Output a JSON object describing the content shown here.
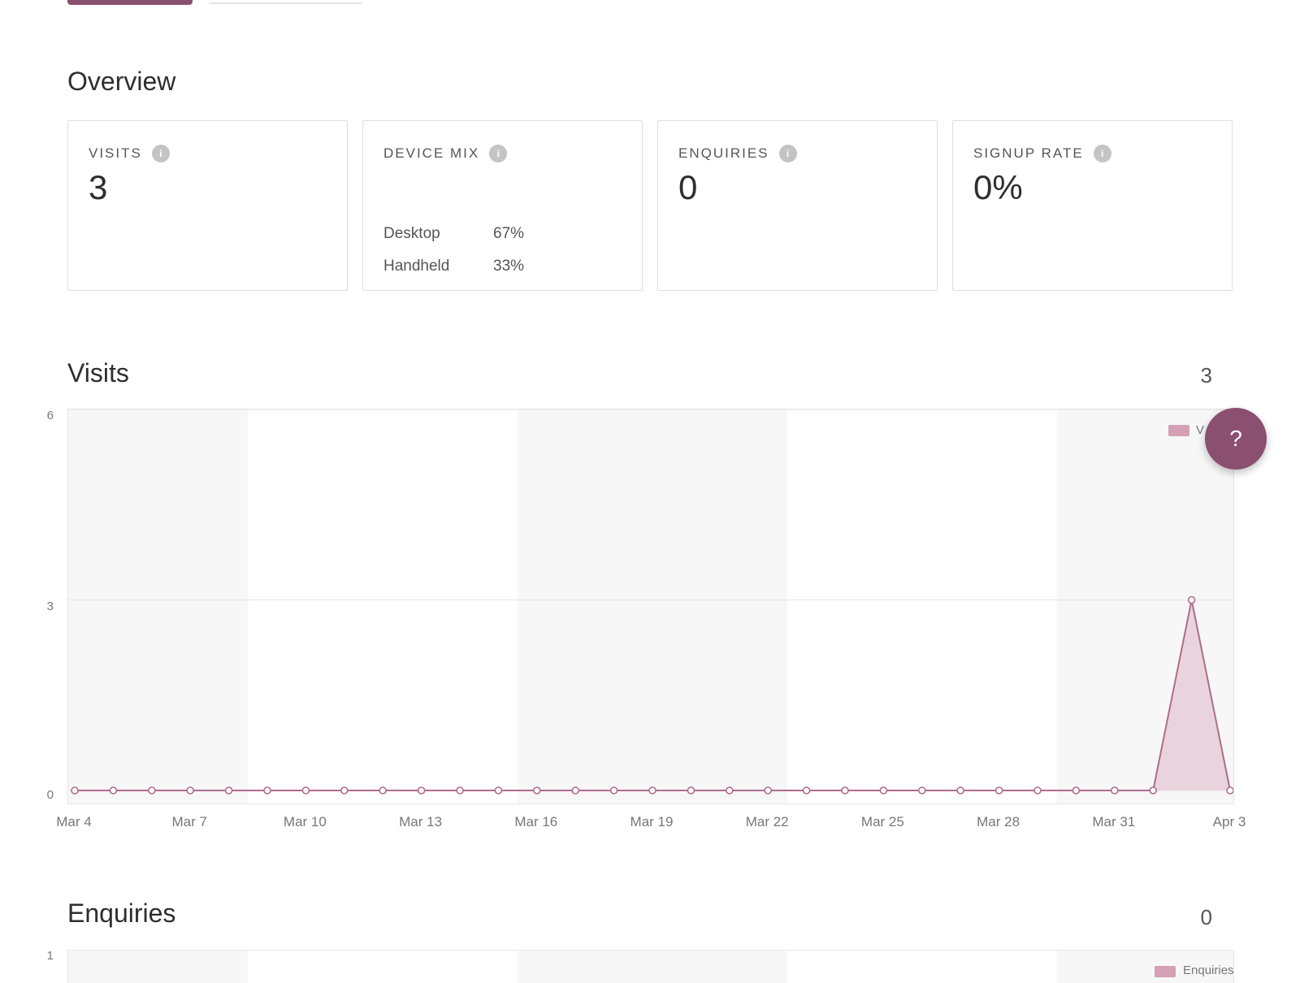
{
  "overview": {
    "title": "Overview",
    "cards": [
      {
        "label": "VISITS",
        "value": "3"
      },
      {
        "label": "DEVICE MIX",
        "rows": [
          {
            "name": "Desktop",
            "pct": "67%"
          },
          {
            "name": "Handheld",
            "pct": "33%"
          }
        ]
      },
      {
        "label": "ENQUIRIES",
        "value": "0"
      },
      {
        "label": "SIGNUP RATE",
        "value": "0%"
      }
    ]
  },
  "visits": {
    "title": "Visits",
    "total": "3",
    "legend": "V",
    "y_ticks": [
      "6",
      "3",
      "0"
    ],
    "x_ticks": [
      "Mar 4",
      "Mar 7",
      "Mar 10",
      "Mar 13",
      "Mar 16",
      "Mar 19",
      "Mar 22",
      "Mar 25",
      "Mar 28",
      "Mar 31",
      "Apr 3"
    ]
  },
  "enquiries": {
    "title": "Enquiries",
    "total": "0",
    "legend": "Enquiries",
    "y_ticks": [
      "1"
    ]
  },
  "help": {
    "label": "?"
  },
  "colors": {
    "accent": "#8b4f70",
    "line": "#b06c8c",
    "fill": "#e9d4dd",
    "band": "#f7f7f7"
  },
  "chart_data": [
    {
      "type": "area",
      "title": "Visits",
      "x": [
        "Mar 4",
        "Mar 5",
        "Mar 6",
        "Mar 7",
        "Mar 8",
        "Mar 9",
        "Mar 10",
        "Mar 11",
        "Mar 12",
        "Mar 13",
        "Mar 14",
        "Mar 15",
        "Mar 16",
        "Mar 17",
        "Mar 18",
        "Mar 19",
        "Mar 20",
        "Mar 21",
        "Mar 22",
        "Mar 23",
        "Mar 24",
        "Mar 25",
        "Mar 26",
        "Mar 27",
        "Mar 28",
        "Mar 29",
        "Mar 30",
        "Mar 31",
        "Apr 1",
        "Apr 2",
        "Apr 3"
      ],
      "series": [
        {
          "name": "V",
          "values": [
            0,
            0,
            0,
            0,
            0,
            0,
            0,
            0,
            0,
            0,
            0,
            0,
            0,
            0,
            0,
            0,
            0,
            0,
            0,
            0,
            0,
            0,
            0,
            0,
            0,
            0,
            0,
            0,
            0,
            3,
            0
          ]
        }
      ],
      "ylim": [
        0,
        6
      ],
      "grid": true,
      "legend": "top-right"
    },
    {
      "type": "area",
      "title": "Enquiries",
      "series": [
        {
          "name": "Enquiries",
          "values": []
        }
      ],
      "ylim": [
        0,
        1
      ],
      "legend": "top-right"
    }
  ]
}
